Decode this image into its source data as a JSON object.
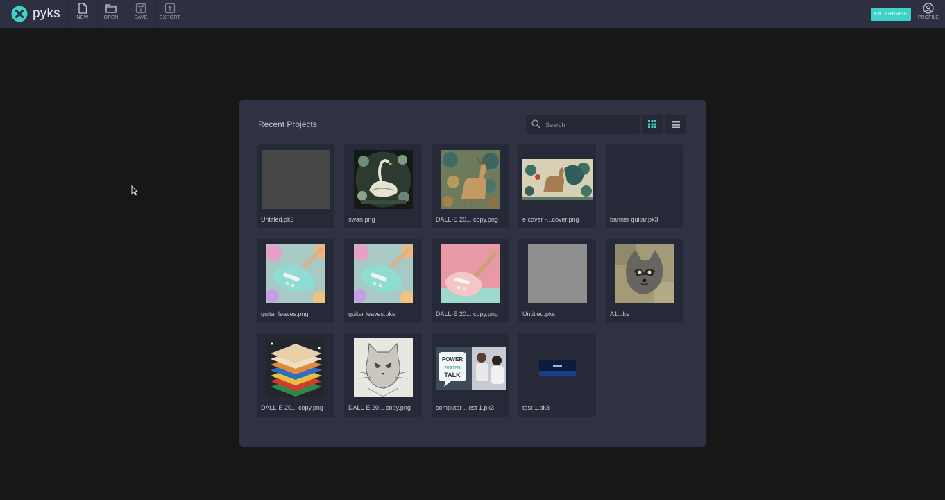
{
  "app": {
    "brand": "pyks",
    "toolbar": {
      "new_label": "NEW",
      "open_label": "OPEN",
      "save_label": "SAVE",
      "export_label": "EXPORT"
    },
    "enterprise_label": "ENTERPRISE",
    "profile_label": "PROFILE",
    "accent_color": "#3fd3c7"
  },
  "panel": {
    "title": "Recent Projects",
    "search_placeholder": "Search",
    "view_mode": "grid"
  },
  "projects": [
    {
      "name": "Untitled.pk3",
      "thumb": "gray-square"
    },
    {
      "name": "swan.png",
      "thumb": "swan-art"
    },
    {
      "name": "DALL·E 20... copy.png",
      "thumb": "deer-art"
    },
    {
      "name": "e cover -...cover.png",
      "thumb": "peacock-deer-banner"
    },
    {
      "name": "banner quitar.pk3",
      "thumb": "empty"
    },
    {
      "name": "guitar leaves.png",
      "thumb": "teal-guitar"
    },
    {
      "name": "guitar leaves.pks",
      "thumb": "teal-guitar"
    },
    {
      "name": "DALL·E 20... copy.png",
      "thumb": "pink-guitar"
    },
    {
      "name": "Untitled.pks",
      "thumb": "light-gray-square"
    },
    {
      "name": "A1.pks",
      "thumb": "raccoon-art"
    },
    {
      "name": "DALL·E 20... copy.png",
      "thumb": "layered-sandwich"
    },
    {
      "name": "DALL·E 20... copy.png",
      "thumb": "cat-sketch"
    },
    {
      "name": "computer ...est 1.pk3",
      "thumb": "power-positive-talk"
    },
    {
      "name": "test 1.pk3",
      "thumb": "dark-blue-banner"
    }
  ],
  "thumb_texts": {
    "power_line1": "POWER",
    "power_line2": "POSITIVE",
    "power_line3": "TALK"
  }
}
